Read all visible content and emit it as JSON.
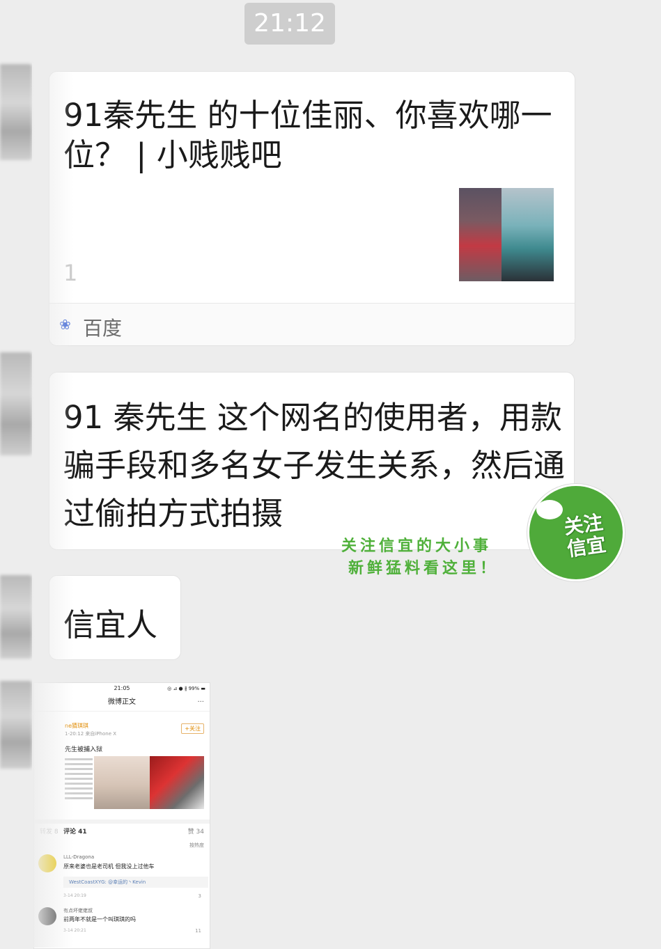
{
  "timestamp": "21:12",
  "link_card": {
    "title": "91秦先生 的十位佳丽、你喜欢哪一位？ | 小贱贱吧",
    "desc": "1",
    "source": "百度",
    "source_icon": "baidu-paw-icon"
  },
  "text_message": "91 秦先生 这个网名的使用者，用款骗手段和多名女子发生关系，然后通过偷拍方式拍摄",
  "short_message": "信宜人",
  "watermark": {
    "badge_text": "关注信宜",
    "line1": "关注信宜的大小事",
    "line2": "新鲜猛料看这里！",
    "color": "#4faa3a"
  },
  "screenshot": {
    "status_time": "21:05",
    "status_right": "◎ ⊿ ● ∦ 99% ▬",
    "nav_title": "微博正文",
    "nav_more": "···",
    "user": "ne猜琪琪",
    "meta": "1-20:12  来自iPhone X",
    "follow": "+关注",
    "post": "先生被捕入狱",
    "tab_repost": "转发 8",
    "tab_comments": "评论 41",
    "tab_likes": "赞 34",
    "sort": "按热度",
    "comments": [
      {
        "name": "LLL-Dragona",
        "text": "原来老婆也是老司机  但我没上过他车",
        "reply": "WestCoastXYG: @幸运的丶Kevin",
        "date": "3-14 20:19",
        "likes": "3"
      },
      {
        "name": "有点坏佬佬叔",
        "text": "前两年不就是一个叫琪琪的吗",
        "date": "3-14 20:21",
        "likes": "11"
      }
    ]
  }
}
